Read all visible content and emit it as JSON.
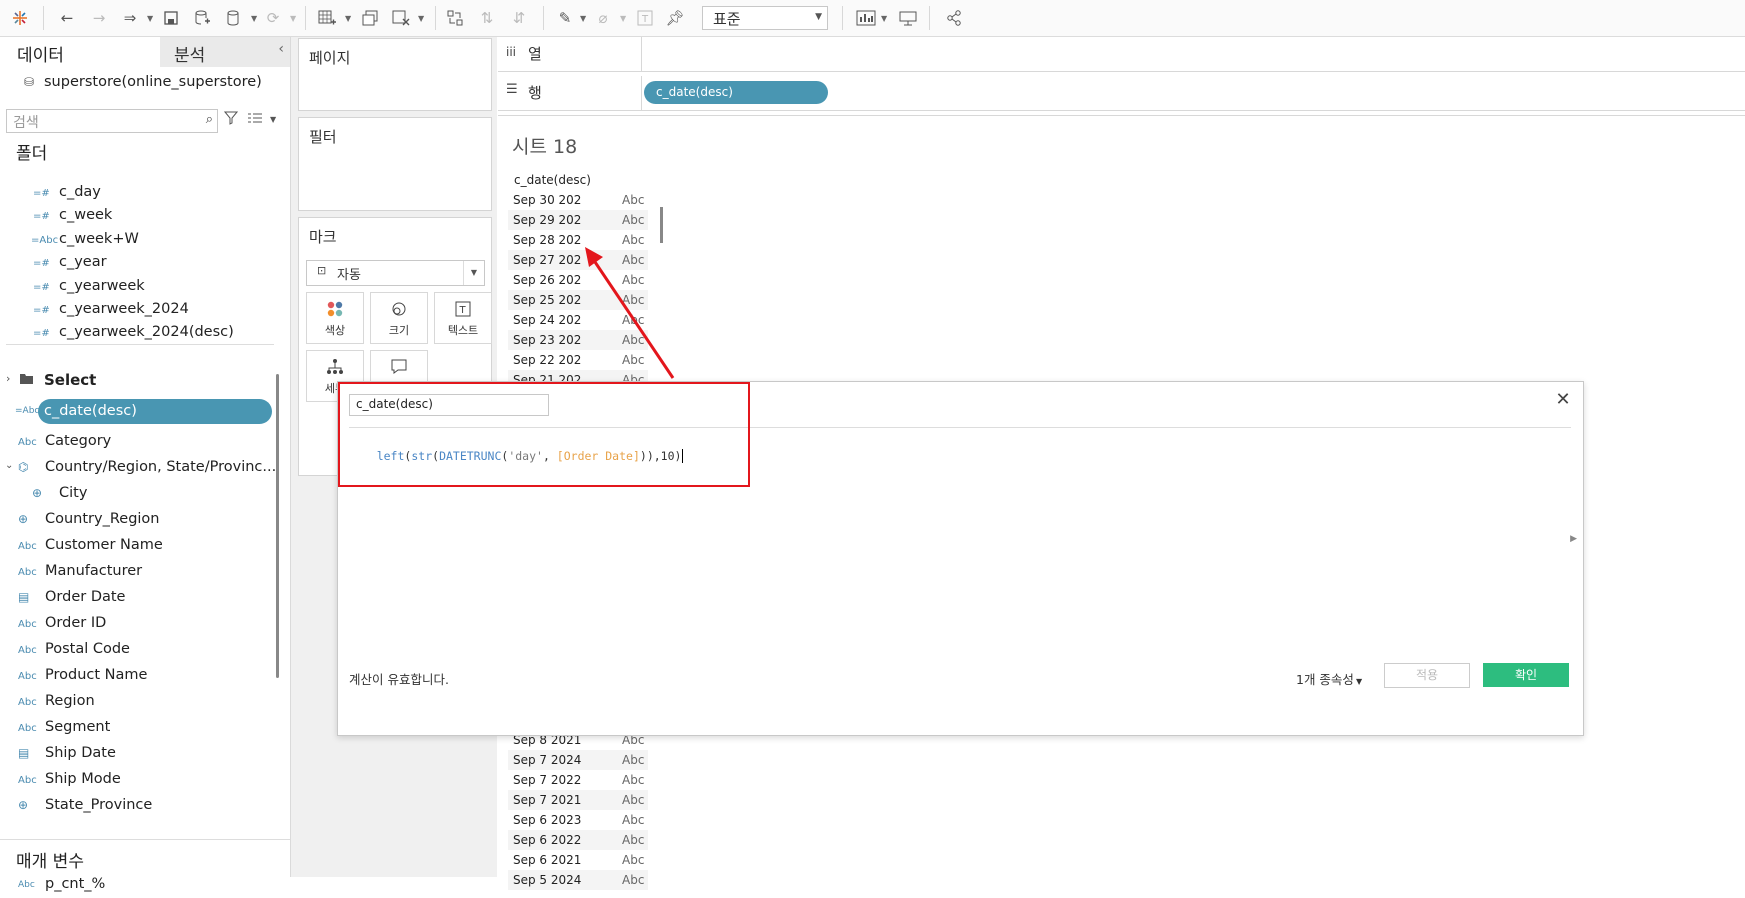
{
  "toolbar": {
    "presentation_mode": "표준",
    "icons": [
      "tableau-logo-icon",
      "back-icon",
      "forward-icon",
      "redo-icon",
      "save-icon",
      "new-datasource-icon",
      "datasource-icon",
      "refresh-icon",
      "new-worksheet-icon",
      "duplicate-icon",
      "clear-sheet-icon",
      "swap-icon",
      "sort-asc-icon",
      "sort-desc-icon",
      "highlight-icon",
      "group-icon",
      "label-icon",
      "pin-icon",
      "show-me-icon",
      "present-icon",
      "share-icon"
    ]
  },
  "data_pane": {
    "tab_data": "데이터",
    "tab_analysis": "분석",
    "datasource": "superstore(online_superstore)",
    "search_placeholder": "검색",
    "folder_header": "폴더",
    "folder_fields": [
      {
        "type": "=#",
        "name": "c_day"
      },
      {
        "type": "=#",
        "name": "c_week"
      },
      {
        "type": "=Abc",
        "name": "c_week+W"
      },
      {
        "type": "=#",
        "name": "c_year"
      },
      {
        "type": "=#",
        "name": "c_yearweek"
      },
      {
        "type": "=#",
        "name": "c_yearweek_2024"
      },
      {
        "type": "=#",
        "name": "c_yearweek_2024(desc)"
      }
    ],
    "select_folder": "Select",
    "selected_field": {
      "type": "=Abc",
      "name": "c_date(desc)"
    },
    "fields": [
      {
        "type": "Abc",
        "name": "Category"
      },
      {
        "type": "hier",
        "name": "Country/Region, State/Provinc..."
      },
      {
        "type": "globe",
        "name": "City"
      },
      {
        "type": "globe",
        "name": "Country_Region"
      },
      {
        "type": "Abc",
        "name": "Customer Name"
      },
      {
        "type": "Abc",
        "name": "Manufacturer"
      },
      {
        "type": "cal",
        "name": "Order Date"
      },
      {
        "type": "Abc",
        "name": "Order ID"
      },
      {
        "type": "Abc",
        "name": "Postal Code"
      },
      {
        "type": "Abc",
        "name": "Product Name"
      },
      {
        "type": "Abc",
        "name": "Region"
      },
      {
        "type": "Abc",
        "name": "Segment"
      },
      {
        "type": "cal",
        "name": "Ship Date"
      },
      {
        "type": "Abc",
        "name": "Ship Mode"
      },
      {
        "type": "globe",
        "name": "State_Province"
      }
    ],
    "params_header": "매개 변수",
    "params": [
      {
        "type": "Abc",
        "name": "p_cnt_%"
      }
    ]
  },
  "shelves": {
    "pages": "페이지",
    "filters": "필터",
    "marks": "마크",
    "mark_type": "자동",
    "mark_buttons": [
      "색상",
      "크기",
      "텍스트",
      "세부",
      ""
    ],
    "columns_label": "열",
    "rows_label": "행",
    "rows_pill": "c_date(desc)"
  },
  "sheet": {
    "title": "시트 18",
    "column_header": "c_date(desc)",
    "rows_top": [
      [
        "Sep 30 202",
        "Abc"
      ],
      [
        "Sep 29 202",
        "Abc"
      ],
      [
        "Sep 28 202",
        "Abc"
      ],
      [
        "Sep 27 202",
        "Abc"
      ],
      [
        "Sep 26 202",
        "Abc"
      ],
      [
        "Sep 25 202",
        "Abc"
      ],
      [
        "Sep 24 202",
        "Abc"
      ],
      [
        "Sep 23 202",
        "Abc"
      ],
      [
        "Sep 22 202",
        "Abc"
      ],
      [
        "Sep 21 202",
        "Abc"
      ]
    ],
    "rows_bottom": [
      [
        "Sep 8 2021",
        "Abc"
      ],
      [
        "Sep 7 2024",
        "Abc"
      ],
      [
        "Sep 7 2022",
        "Abc"
      ],
      [
        "Sep 7 2021",
        "Abc"
      ],
      [
        "Sep 6 2023",
        "Abc"
      ],
      [
        "Sep 6 2022",
        "Abc"
      ],
      [
        "Sep 6 2021",
        "Abc"
      ],
      [
        "Sep 5 2024",
        "Abc"
      ]
    ]
  },
  "calc_dialog": {
    "name": "c_date(desc)",
    "formula": {
      "fn1": "left",
      "p1": "(",
      "fn2": "str",
      "p2": "(",
      "fn3": "DATETRUNC",
      "p3": "(",
      "arg": "'day'",
      "comma": ", ",
      "field": "[Order Date]",
      "tail": ")),10)"
    },
    "status": "계산이 유효합니다.",
    "dependencies": "1개 종속성",
    "apply": "적용",
    "ok": "확인"
  },
  "colors": {
    "accent_blue": "#4996b2",
    "ok_green": "#2dbd7f",
    "annotation_red": "#e3161c",
    "formula_fn": "#4a86c5",
    "formula_field": "#e8a34a",
    "formula_string": "#7a7a7a"
  }
}
